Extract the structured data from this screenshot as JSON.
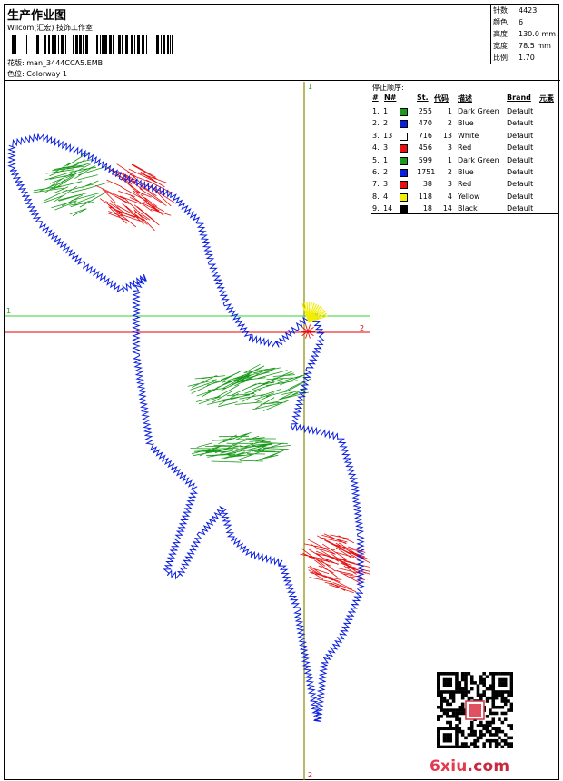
{
  "header": {
    "title": "生产作业图",
    "subtitle": "Wilcom(汇宏) 技饰工作室",
    "pattern_label": "花版:",
    "pattern_value": "man_3444CCA5.EMB",
    "colorway_label": "色位:",
    "colorway_value": "Colorway 1"
  },
  "stats": [
    {
      "label": "针数:",
      "value": "4423"
    },
    {
      "label": "颜色:",
      "value": "6"
    },
    {
      "label": "高度:",
      "value": "130.0 mm"
    },
    {
      "label": "宽度:",
      "value": "78.5 mm"
    },
    {
      "label": "比例:",
      "value": "1.70"
    }
  ],
  "design": {
    "marker_v_top": "1",
    "marker_v_bottom": "2",
    "marker_h_left": "1",
    "marker_h_right": "2"
  },
  "sequence": {
    "title": "停止顺序:",
    "columns": [
      "#",
      "N#",
      "St.",
      "代码",
      "描述",
      "Brand",
      "元素"
    ],
    "rows": [
      {
        "idx": "1.",
        "n": "1",
        "st": "255",
        "code": "1",
        "desc": "Dark Green",
        "brand": "Default",
        "color": "#1a9a1a"
      },
      {
        "idx": "2.",
        "n": "2",
        "st": "470",
        "code": "2",
        "desc": "Blue",
        "brand": "Default",
        "color": "#0a1ee0"
      },
      {
        "idx": "3.",
        "n": "13",
        "st": "716",
        "code": "13",
        "desc": "White",
        "brand": "Default",
        "color": "#ffffff"
      },
      {
        "idx": "4.",
        "n": "3",
        "st": "456",
        "code": "3",
        "desc": "Red",
        "brand": "Default",
        "color": "#e81010"
      },
      {
        "idx": "5.",
        "n": "1",
        "st": "599",
        "code": "1",
        "desc": "Dark Green",
        "brand": "Default",
        "color": "#1a9a1a"
      },
      {
        "idx": "6.",
        "n": "2",
        "st": "1751",
        "code": "2",
        "desc": "Blue",
        "brand": "Default",
        "color": "#0a1ee0"
      },
      {
        "idx": "7.",
        "n": "3",
        "st": "38",
        "code": "3",
        "desc": "Red",
        "brand": "Default",
        "color": "#e81010"
      },
      {
        "idx": "8.",
        "n": "4",
        "st": "118",
        "code": "4",
        "desc": "Yellow",
        "brand": "Default",
        "color": "#f2ee00"
      },
      {
        "idx": "9.",
        "n": "14",
        "st": "18",
        "code": "14",
        "desc": "Black",
        "brand": "Default",
        "color": "#000000"
      }
    ]
  },
  "watermark": {
    "site_main": "6xiu",
    "site_dot": ".com"
  },
  "colors": {
    "blue": "#0a1ee0",
    "green": "#1a9a1a",
    "red": "#e81010",
    "yellow": "#f2ee00",
    "guide_olive": "#8a8a00",
    "guide_green": "#30d030",
    "guide_red": "#e00000"
  }
}
